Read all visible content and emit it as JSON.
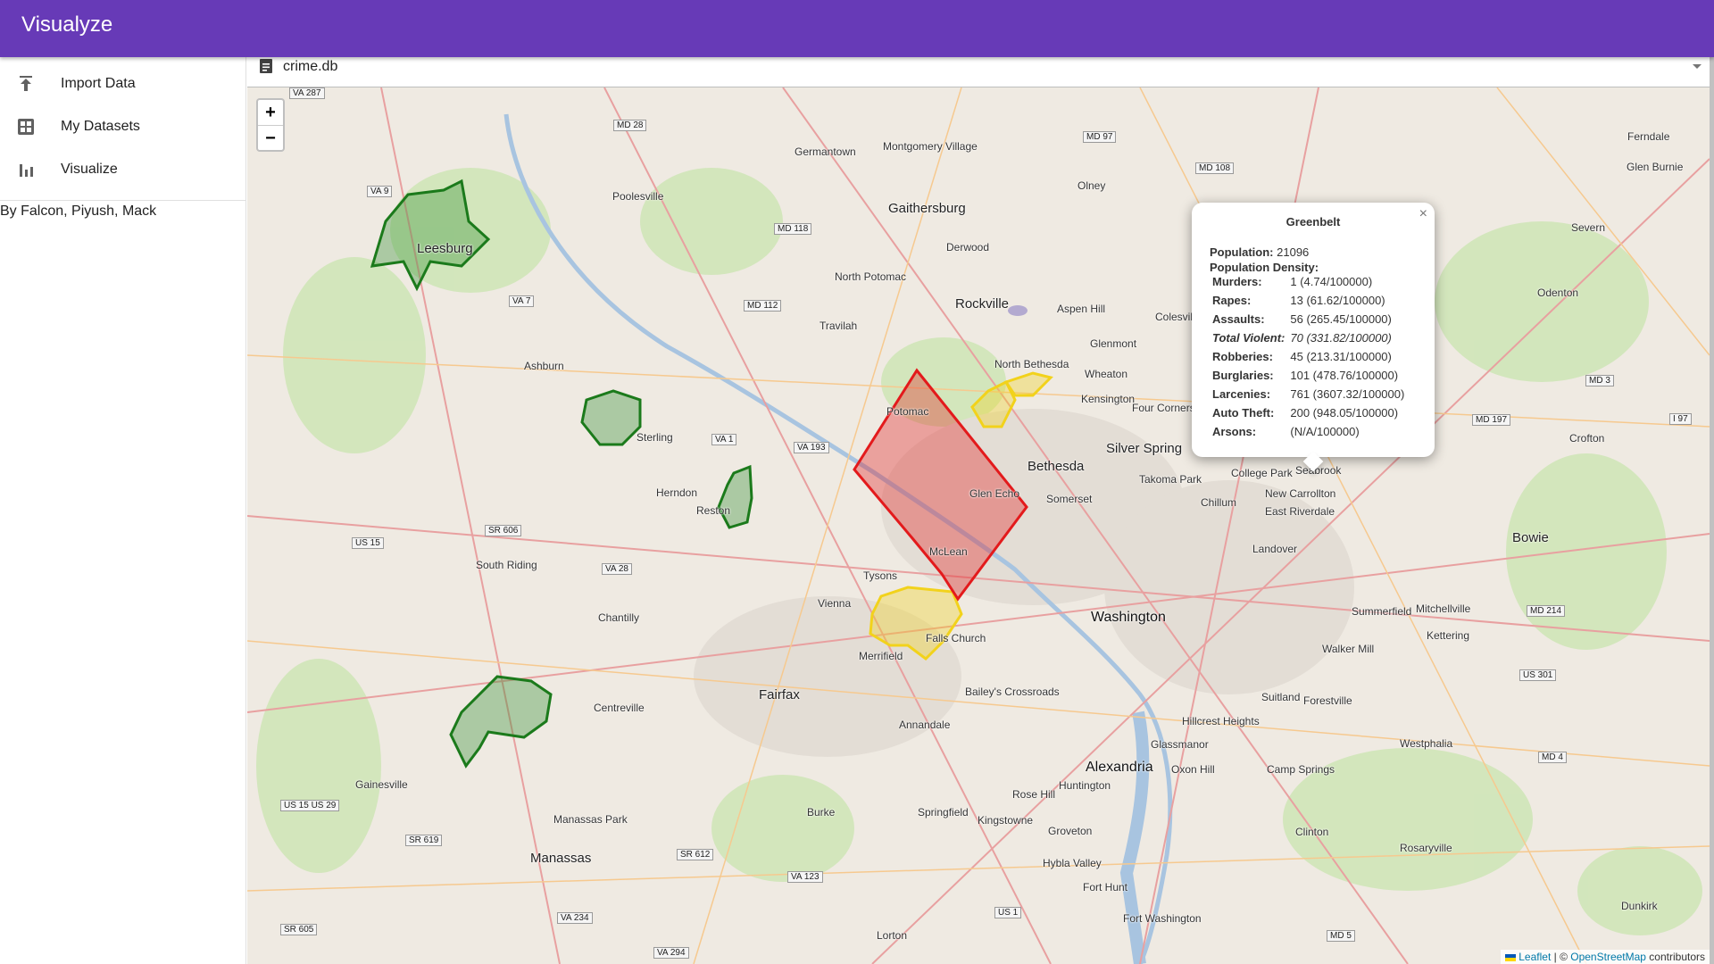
{
  "app": {
    "title": "Visualyze"
  },
  "sidebar": {
    "items": [
      {
        "label": "Import Data",
        "icon": "upload-icon"
      },
      {
        "label": "My Datasets",
        "icon": "grid-icon"
      },
      {
        "label": "Visualize",
        "icon": "bar-chart-icon"
      }
    ],
    "credit": "By Falcon, Piyush, Mack"
  },
  "dataset_select": {
    "value": "crime.db",
    "icon": "document-icon"
  },
  "map": {
    "zoom_in": "+",
    "zoom_out": "−",
    "places": {
      "washington": "Washington",
      "bethesda": "Bethesda",
      "silver_spring": "Silver Spring",
      "rockville": "Rockville",
      "gaithersburg": "Gaithersburg",
      "alexandria": "Alexandria",
      "fairfax": "Fairfax",
      "leesburg": "Leesburg",
      "manassas": "Manassas",
      "herndon": "Herndon",
      "vienna": "Vienna",
      "bowie": "Bowie",
      "college_park": "College Park",
      "mclean": "McLean",
      "falls_church": "Falls Church",
      "springfield": "Springfield",
      "chantilly": "Chantilly",
      "reston": "Reston",
      "sterling": "Sterling",
      "ashburn": "Ashburn",
      "potomac": "Potomac",
      "annandale": "Annandale",
      "burke": "Burke",
      "centreville": "Centreville",
      "germantown": "Germantown",
      "olney": "Olney",
      "laurel_hint": "Odenton",
      "landover": "Landover",
      "suitland": "Suitland",
      "fort_washington": "Fort Washington",
      "takoma_park": "Takoma Park",
      "greenbelt_area": "Seabrook",
      "new_carrollton": "New Carrollton",
      "district_heights": "Forestville",
      "south_riding": "South Riding",
      "gainesville": "Gainesville",
      "poolesville": "Poolesville",
      "merrifield": "Merrifield",
      "tysons": "Tysons",
      "kensington": "Kensington",
      "wheaton": "Wheaton",
      "glenmont": "Glenmont",
      "camp_springs": "Camp Springs",
      "clinton": "Clinton",
      "oxon_hill": "Oxon Hill",
      "lorton": "Lorton",
      "fort_hunt": "Fort Hunt",
      "crofton": "Crofton",
      "glen_burnie": "Glen Burnie",
      "severn": "Severn",
      "dunkirk": "Dunkirk",
      "rosaryville": "Rosaryville",
      "westphalia": "Westphalia",
      "mitchellville": "Mitchellville",
      "kettering": "Kettering",
      "walker_mill": "Walker Mill",
      "summerfield": "Summerfield",
      "ferndale": "Ferndale",
      "riverdale": "East Riverdale",
      "chillum": "Chillum",
      "huntington": "Huntington",
      "rose_hill": "Rose Hill",
      "groveton": "Groveton",
      "hybla_valley": "Hybla Valley",
      "kingstowne": "Kingstowne",
      "glassmanor": "Glassmanor",
      "hillcrest": "Hillcrest Heights",
      "baileys": "Bailey's Crossroads",
      "manassas_park": "Manassas Park",
      "darnestown": "Travilah",
      "north_potomac": "North Potomac",
      "derwood": "Derwood",
      "montgomery_village": "Montgomery Village",
      "aspen_hill": "Aspen Hill",
      "north_bethesda": "North Bethesda",
      "colesville": "Colesville",
      "four_corners": "Four Corners",
      "somerset": "Somerset",
      "glen_echo": "Glen Echo"
    },
    "routes": [
      "VA 287",
      "MD 28",
      "VA 9",
      "VA 7",
      "MD 112",
      "MD 118",
      "MD 97",
      "MD 108",
      "VA 1",
      "VA 193",
      "SR 606",
      "US 15",
      "VA 28",
      "SR 619",
      "US 15 US 29",
      "SR 605",
      "VA 234",
      "VA 294",
      "SR 612",
      "VA 123",
      "US 1",
      "MD 5",
      "MD 4",
      "MD 214",
      "US 301",
      "MD 3",
      "MD 197",
      "I 97"
    ],
    "attribution": {
      "leaflet": "Leaflet",
      "sep": " | © ",
      "osm": "OpenStreetMap",
      "tail": " contributors"
    }
  },
  "popup": {
    "title": "Greenbelt",
    "population_label": "Population:",
    "population_value": "21096",
    "density_label": "Population Density:",
    "rows": [
      {
        "k": "Murders:",
        "v": "1 (4.74/100000)"
      },
      {
        "k": "Rapes:",
        "v": "13 (61.62/100000)"
      },
      {
        "k": "Assaults:",
        "v": "56 (265.45/100000)"
      },
      {
        "k": "Total Violent:",
        "v": "70 (331.82/100000)"
      },
      {
        "k": "Robberies:",
        "v": "45 (213.31/100000)"
      },
      {
        "k": "Burglaries:",
        "v": "101 (478.76/100000)"
      },
      {
        "k": "Larcenies:",
        "v": "761 (3607.32/100000)"
      },
      {
        "k": "Auto Theft:",
        "v": "200 (948.05/100000)"
      },
      {
        "k": "Arsons:",
        "v": "(N/A/100000)"
      }
    ],
    "close": "×"
  },
  "colors": {
    "appbar": "#673ab7",
    "low": "#1b7a1b",
    "mid": "#f2d21b",
    "high": "#e31a1c"
  }
}
